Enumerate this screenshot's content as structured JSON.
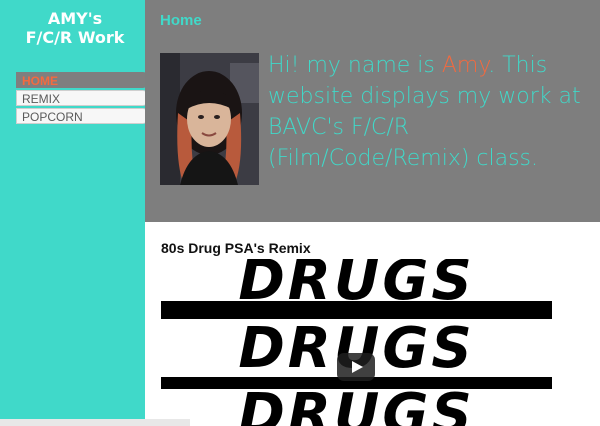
{
  "sidebar": {
    "title_line1": "AMY's",
    "title_line2": "F/C/R Work",
    "nav": [
      {
        "label": "HOME",
        "active": true
      },
      {
        "label": "REMIX",
        "active": false
      },
      {
        "label": "POPCORN",
        "active": false
      }
    ]
  },
  "header": {
    "page_title": "Home",
    "intro_prefix": "Hi! my name is ",
    "intro_name": "Amy",
    "intro_suffix": ". This website displays my work at BAVC's F/C/R (Film/Code/Remix) class."
  },
  "content": {
    "section_title": "80s Drug PSA's Remix",
    "video_words": [
      "DRUGS",
      "DRUGS",
      "DRUGS"
    ]
  },
  "colors": {
    "accent_teal": "#40d9c9",
    "accent_orange": "#f36a3f",
    "header_gray": "#7e7e7e"
  },
  "icons": {
    "share": "share-icon",
    "info": "info-icon",
    "play": "play-icon"
  }
}
